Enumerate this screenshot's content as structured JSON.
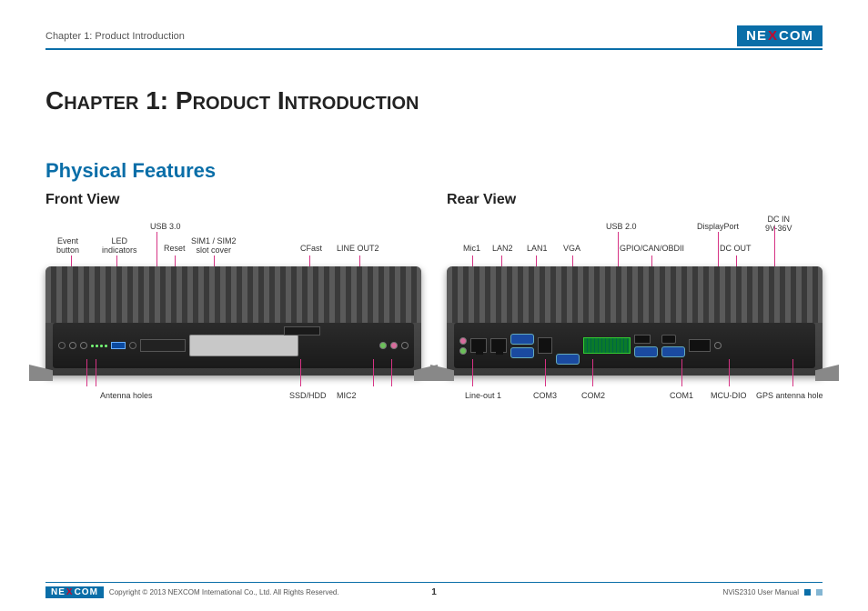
{
  "brand": {
    "name_pre": "NE",
    "name_x": "X",
    "name_post": "COM"
  },
  "header": {
    "chapter_label": "Chapter 1: Product Introduction"
  },
  "title": "Chapter 1: Product Introduction",
  "section": "Physical Features",
  "front": {
    "title": "Front View",
    "top_labels": {
      "event_button": "Event\nbutton",
      "led_indicators": "LED\nindicators",
      "usb30": "USB 3.0",
      "reset": "Reset",
      "sim_cover": "SIM1 / SIM2\nslot cover",
      "cfast": "CFast",
      "lineout2": "LINE OUT2"
    },
    "bottom_labels": {
      "antenna": "Antenna holes",
      "ssd": "SSD/HDD",
      "mic2": "MIC2"
    }
  },
  "rear": {
    "title": "Rear View",
    "top_labels": {
      "mic1": "Mic1",
      "lan2": "LAN2",
      "lan1": "LAN1",
      "vga": "VGA",
      "usb20": "USB 2.0",
      "gpio": "GPIO/CAN/OBDII",
      "dp": "DisplayPort",
      "dcout": "DC OUT",
      "dcin": "DC IN\n9V-36V"
    },
    "bottom_labels": {
      "lineout1": "Line-out 1",
      "com3": "COM3",
      "com2": "COM2",
      "com1": "COM1",
      "mcudio": "MCU-DIO",
      "gps": "GPS antenna hole"
    }
  },
  "footer": {
    "copyright": "Copyright © 2013 NEXCOM International Co., Ltd. All Rights Reserved.",
    "page": "1",
    "doc": "NViS2310 User Manual"
  }
}
